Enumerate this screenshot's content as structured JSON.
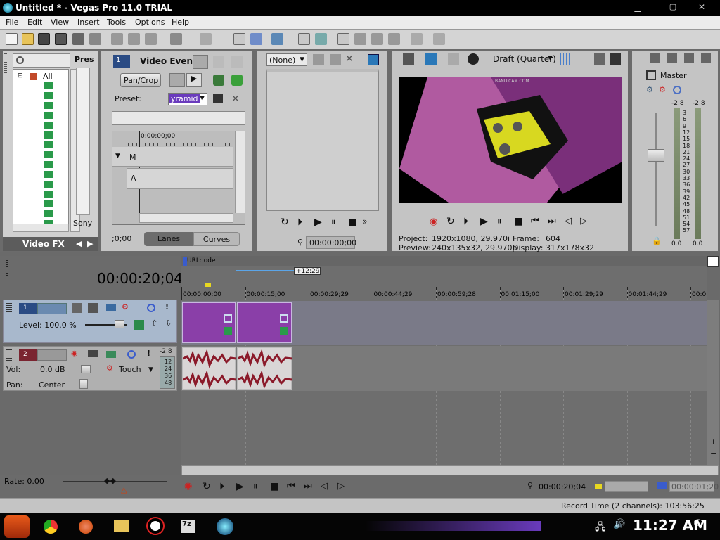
{
  "window": {
    "title": "Untitled * - Vegas Pro 11.0 TRIAL"
  },
  "menu": [
    "File",
    "Edit",
    "View",
    "Insert",
    "Tools",
    "Options",
    "Help"
  ],
  "explorer": {
    "root_label": "All",
    "tab_label": "Video FX",
    "col_label": "Pres",
    "sub_label": "Sony"
  },
  "event_fx": {
    "track_num": "1",
    "title": "Video Event",
    "fx_name": "Pan/Crop",
    "preset_label": "Preset:",
    "preset_value": "yramid",
    "kf_time": "0:00:00;00",
    "lane_m": "M",
    "lane_a": "A",
    "time_left": ";0;00",
    "btn_lanes": "Lanes",
    "btn_curves": "Curves"
  },
  "trimmer": {
    "dropdown": "(None)",
    "timecode": "00:00:00;00"
  },
  "preview": {
    "quality": "Draft (Quarter)",
    "project_label": "Project:",
    "project_value": "1920x1080, 29.970i",
    "preview_label": "Preview:",
    "preview_value": "240x135x32, 29.970p",
    "frame_label": "Frame:",
    "frame_value": "604",
    "display_label": "Display:",
    "display_value": "317x178x32",
    "watermark": "BANDICAM.COM"
  },
  "mixer": {
    "title": "Master",
    "peak_l": "-2.8",
    "peak_r": "-2.8",
    "scale": [
      "3",
      "6",
      "9",
      "12",
      "15",
      "18",
      "21",
      "24",
      "27",
      "30",
      "33",
      "36",
      "39",
      "42",
      "45",
      "48",
      "51",
      "54",
      "57"
    ],
    "val_l": "0.0",
    "val_r": "0.0"
  },
  "timeline": {
    "cursor_time": "00:00:20;04",
    "marker": "URL: ode",
    "region": "+12:29",
    "ruler": [
      "00:00:00;00",
      "00:00:15;00",
      "00:00:29;29",
      "00:00:44;29",
      "00:00:59;28",
      "00:01:15;00",
      "00:01:29;29",
      "00:01:44;29",
      "00:0"
    ]
  },
  "track1": {
    "num": "1",
    "level_label": "Level: 100.0 %"
  },
  "track2": {
    "num": "2",
    "peak": "-2.8",
    "vol_label": "Vol:",
    "vol_value": "0.0 dB",
    "touch": "Touch",
    "pan_label": "Pan:",
    "pan_value": "Center",
    "meter": [
      "12",
      "24",
      "36",
      "48"
    ]
  },
  "transport": {
    "rate": "Rate: 0.00",
    "time": "00:00:20;04",
    "end_time": "00:00:01;20"
  },
  "status": {
    "record_time": "Record Time (2 channels): 103:56:25"
  },
  "taskbar": {
    "clock": "11:27 AM",
    "app_7z": "7z"
  },
  "colors": {
    "clip_video": "#8a3fa8",
    "waveform": "#8b1a2a",
    "accent": "#6a3bbd"
  }
}
